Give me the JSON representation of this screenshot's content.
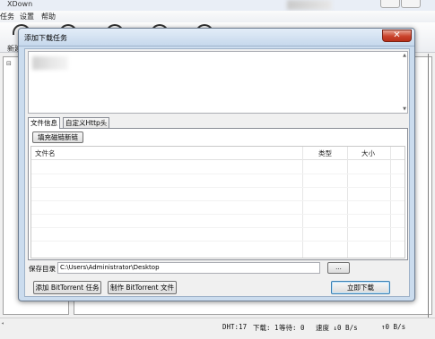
{
  "main_window": {
    "title": "XDown",
    "menu": [
      "任务",
      "设置",
      "帮助"
    ],
    "toolbar_label": "新建"
  },
  "status_bar": {
    "dht": "DHT:17",
    "downloading": "下载: 1",
    "waiting": "等待: 0",
    "download_speed": "速度 ↓0 B/s",
    "upload_speed": "↑0 B/s"
  },
  "dialog": {
    "title": "添加下载任务",
    "close_icon": "close-icon",
    "url_text": "",
    "tabs": [
      {
        "label": "文件信息",
        "active": true
      },
      {
        "label": "自定义Http头",
        "active": false
      }
    ],
    "fill_button_label": "填充磁链新链",
    "file_table": {
      "columns": [
        "文件名",
        "类型",
        "大小"
      ],
      "rows": []
    },
    "save_dir_label": "保存目录",
    "save_dir_value": "C:\\Users\\Administrator\\Desktop",
    "browse_label": "...",
    "add_bt_label": "添加 BitTorrent 任务",
    "make_bt_label": "制作 BitTorrent 文件",
    "download_now_label": "立即下载"
  },
  "colors": {
    "dialog_frame": "#cbdcee",
    "close_button": "#c9432c",
    "default_button_border": "#3c7fb1"
  }
}
